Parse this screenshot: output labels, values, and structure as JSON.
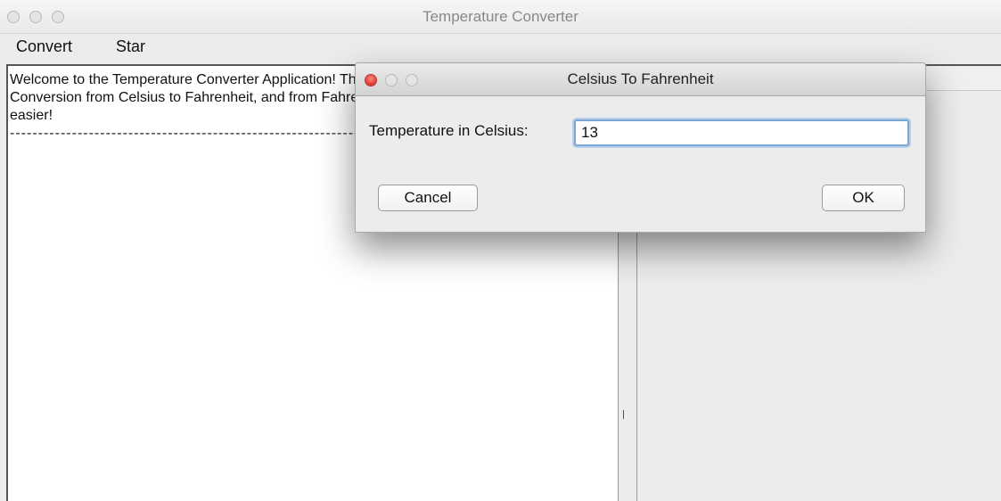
{
  "window": {
    "title": "Temperature Converter"
  },
  "menubar": {
    "items": [
      "Convert",
      "Star"
    ]
  },
  "text_area": {
    "lines": [
      "Welcome to the Temperature Converter Application! This program makes",
      "Conversion from Celsius to Fahrenheit, and from Fahrenheit to Celsius",
      "easier!",
      "----------------------------------------------------------------"
    ]
  },
  "dialog": {
    "title": "Celsius To Fahrenheit",
    "label": "Temperature in Celsius:",
    "input_value": "13",
    "cancel_label": "Cancel",
    "ok_label": "OK"
  },
  "colors": {
    "close_button": "#e0443b",
    "focus_ring": "#7ba7d6"
  }
}
